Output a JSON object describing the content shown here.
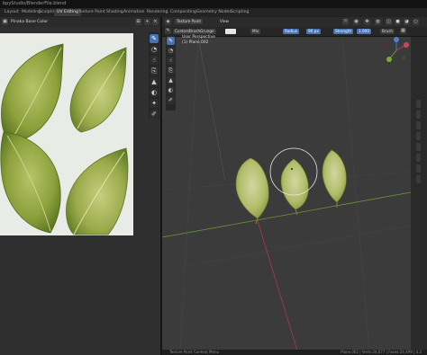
{
  "window": {
    "title": "bpyStudio/BlenderFile.blend"
  },
  "workspace_tabs": [
    {
      "label": "Layout",
      "active": false
    },
    {
      "label": "Modeling",
      "active": false
    },
    {
      "label": "Sculpting",
      "active": false
    },
    {
      "label": "UV Editing",
      "active": true
    },
    {
      "label": "Texture Paint",
      "active": false
    },
    {
      "label": "Shading",
      "active": false
    },
    {
      "label": "Animation",
      "active": false
    },
    {
      "label": "Rendering",
      "active": false
    },
    {
      "label": "Compositing",
      "active": false
    },
    {
      "label": "Geometry Nodes",
      "active": false
    },
    {
      "label": "Scripting",
      "active": false
    }
  ],
  "image_editor": {
    "image_name": "Pinaka Base Color"
  },
  "viewport_header": {
    "mode": "Texture Paint",
    "view_menu": "View"
  },
  "tool_settings": {
    "brush_name": "CustomBrushGrunge",
    "blend": "Mix",
    "radius_label": "Radius",
    "radius_value": "90 px",
    "strength_label": "Strength",
    "strength_value": "1.000",
    "brush_menu": "Brush",
    "color_hex": "#e6e6e6"
  },
  "viewport_overlay": {
    "view": "User Perspective",
    "object": "(1) Plane.002"
  },
  "status_bar": {
    "left": "Texture Paint Context Menu",
    "right": "Plane.002 | Verts:24,677 | Faces:24,499 | 4.2"
  },
  "colors": {
    "accent": "#4772b3",
    "viewport_bg": "#3b3b3b",
    "axis_x": "#b2364b",
    "axis_y": "#6b9a2f"
  }
}
